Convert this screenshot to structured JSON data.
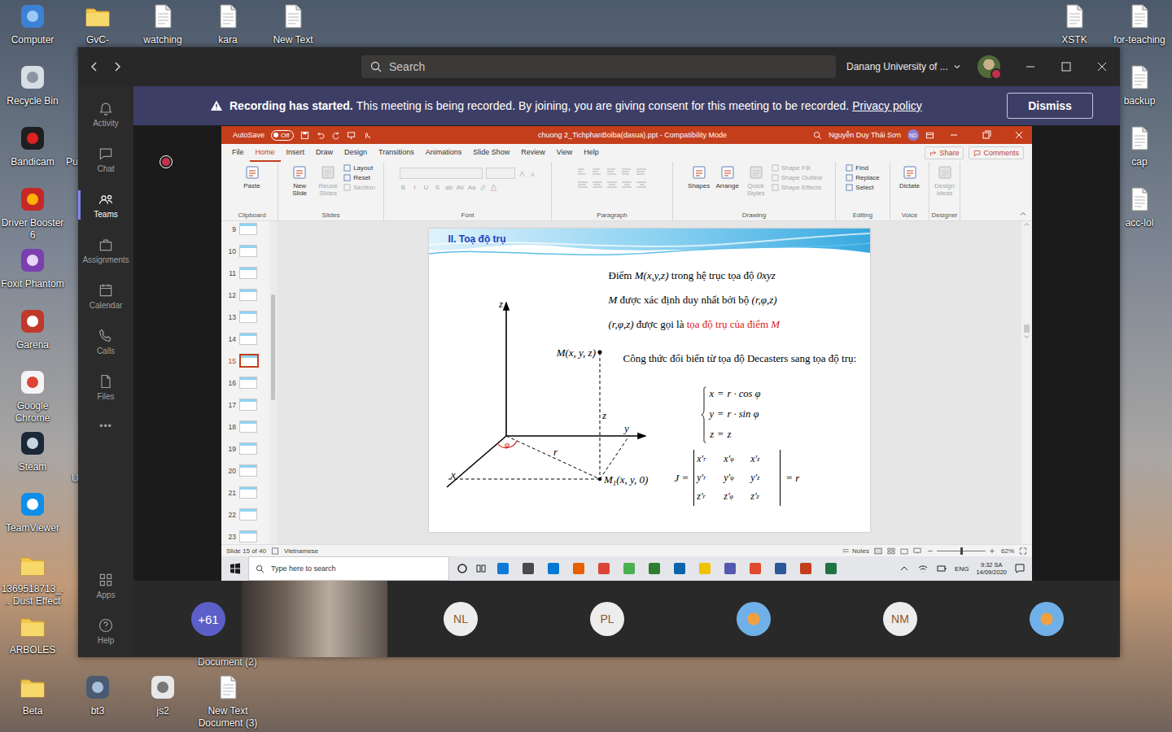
{
  "desktop": {
    "icons": [
      {
        "label": "Computer",
        "kind": "app"
      },
      {
        "label": "GvC-Launcher",
        "kind": "folder"
      },
      {
        "label": "watching",
        "kind": "file"
      },
      {
        "label": "kara",
        "kind": "file"
      },
      {
        "label": "New Text",
        "kind": "file"
      },
      {
        "label": "XSTK",
        "kind": "file"
      },
      {
        "label": "for-teaching",
        "kind": "file"
      },
      {
        "label": "Recycle Bin",
        "kind": "app"
      },
      {
        "label": "backup",
        "kind": "file"
      },
      {
        "label": "Bandicam",
        "kind": "app"
      },
      {
        "label": "cap",
        "kind": "file"
      },
      {
        "label": "Driver Booster 6",
        "kind": "app"
      },
      {
        "label": "acc-lol",
        "kind": "file"
      },
      {
        "label": "Foxit Phantom",
        "kind": "app"
      },
      {
        "label": "Garena",
        "kind": "app"
      },
      {
        "label": "Google Chrome",
        "kind": "app"
      },
      {
        "label": "Steam",
        "kind": "app"
      },
      {
        "label": "TeamViewer",
        "kind": "app"
      },
      {
        "label": "1369518713_... Dust Effect",
        "kind": "folder"
      },
      {
        "label": "ARBOLES",
        "kind": "folder"
      },
      {
        "label": "Beta",
        "kind": "folder"
      },
      {
        "label": "bt3",
        "kind": "app"
      },
      {
        "label": "js2",
        "kind": "app"
      },
      {
        "label": "New Text Document (3)",
        "kind": "file"
      }
    ],
    "partial_labels": [
      "Pu",
      "U",
      "Document (2)"
    ]
  },
  "teams": {
    "search_placeholder": "Search",
    "org": "Danang University of ...",
    "presence": "busy",
    "rail": [
      {
        "label": "Activity",
        "selected": false
      },
      {
        "label": "Chat",
        "selected": false
      },
      {
        "label": "Teams",
        "selected": true
      },
      {
        "label": "Assignments",
        "selected": false
      },
      {
        "label": "Calendar",
        "selected": false
      },
      {
        "label": "Calls",
        "selected": false
      },
      {
        "label": "Files",
        "selected": false
      }
    ],
    "rail_more": "•••",
    "rail_bottom": [
      {
        "label": "Apps"
      },
      {
        "label": "Help"
      }
    ],
    "banner": {
      "bold": "Recording has started.",
      "text": "This meeting is being recorded. By joining, you are giving consent for this meeting to be recorded.",
      "link": "Privacy policy",
      "button": "Dismiss"
    },
    "recording": true,
    "participants": [
      {
        "kind": "count",
        "label": "+61"
      },
      {
        "kind": "video",
        "label": ""
      },
      {
        "kind": "initials",
        "label": "NL"
      },
      {
        "kind": "initials",
        "label": "PL"
      },
      {
        "kind": "photo",
        "label": ""
      },
      {
        "kind": "initials",
        "label": "NM"
      },
      {
        "kind": "photo",
        "label": ""
      }
    ]
  },
  "presentation": {
    "autosave": {
      "label": "AutoSave",
      "state": "Off",
      "on": false
    },
    "title": "chuong 2_TichphanBoiba(dasua).ppt - Compatibility Mode",
    "user": "Nguyễn Duy Thái Sơn",
    "initials": "ND",
    "tabs": [
      {
        "label": "File",
        "selected": false
      },
      {
        "label": "Home",
        "selected": true
      },
      {
        "label": "Insert",
        "selected": false
      },
      {
        "label": "Draw",
        "selected": false
      },
      {
        "label": "Design",
        "selected": false
      },
      {
        "label": "Transitions",
        "selected": false
      },
      {
        "label": "Animations",
        "selected": false
      },
      {
        "label": "Slide Show",
        "selected": false
      },
      {
        "label": "Review",
        "selected": false
      },
      {
        "label": "View",
        "selected": false
      },
      {
        "label": "Help",
        "selected": false
      }
    ],
    "share": "Share",
    "comments": "Comments",
    "ribbon": [
      {
        "label": "Clipboard",
        "kind": "buttons",
        "items": [
          {
            "label": "Paste",
            "size": "large",
            "disabled": false
          }
        ]
      },
      {
        "label": "Slides",
        "kind": "buttons",
        "items": [
          {
            "label": "New Slide",
            "size": "large",
            "disabled": false
          },
          {
            "label": "Reuse Slides",
            "size": "large",
            "disabled": true
          },
          {
            "label": "Layout",
            "size": "small",
            "disabled": false
          },
          {
            "label": "Reset",
            "size": "small",
            "disabled": false
          },
          {
            "label": "Section",
            "size": "small",
            "disabled": true
          }
        ]
      },
      {
        "label": "Font",
        "kind": "font",
        "items": [],
        "glyphs": [
          "B",
          "I",
          "U",
          "S",
          "ab",
          "AV",
          "Aa"
        ]
      },
      {
        "label": "Paragraph",
        "kind": "paragraph",
        "items": []
      },
      {
        "label": "Drawing",
        "kind": "buttons",
        "items": [
          {
            "label": "Shapes",
            "size": "large",
            "disabled": false
          },
          {
            "label": "Arrange",
            "size": "large",
            "disabled": false
          },
          {
            "label": "Quick Styles",
            "size": "large",
            "disabled": true
          },
          {
            "label": "Shape Fill",
            "size": "small",
            "disabled": true
          },
          {
            "label": "Shape Outline",
            "size": "small",
            "disabled": true
          },
          {
            "label": "Shape Effects",
            "size": "small",
            "disabled": true
          }
        ]
      },
      {
        "label": "Editing",
        "kind": "buttons",
        "items": [
          {
            "label": "Find",
            "size": "small",
            "disabled": false
          },
          {
            "label": "Replace",
            "size": "small",
            "disabled": false
          },
          {
            "label": "Select",
            "size": "small",
            "disabled": false
          }
        ]
      },
      {
        "label": "Voice",
        "kind": "buttons",
        "items": [
          {
            "label": "Dictate",
            "size": "large",
            "disabled": false
          }
        ]
      },
      {
        "label": "Designer",
        "kind": "buttons",
        "items": [
          {
            "label": "Design Ideas",
            "size": "large",
            "disabled": true
          }
        ]
      }
    ],
    "slides": [
      {
        "number": "9",
        "selected": false
      },
      {
        "number": "10",
        "selected": false
      },
      {
        "number": "11",
        "selected": false
      },
      {
        "number": "12",
        "selected": false
      },
      {
        "number": "13",
        "selected": false
      },
      {
        "number": "14",
        "selected": false
      },
      {
        "number": "15",
        "selected": true
      },
      {
        "number": "16",
        "selected": false
      },
      {
        "number": "17",
        "selected": false
      },
      {
        "number": "18",
        "selected": false
      },
      {
        "number": "19",
        "selected": false
      },
      {
        "number": "20",
        "selected": false
      },
      {
        "number": "21",
        "selected": false
      },
      {
        "number": "22",
        "selected": false
      },
      {
        "number": "23",
        "selected": false
      }
    ],
    "slide": {
      "title": "II. Toạ độ trụ",
      "lines": [
        [
          {
            "text": "Điểm ",
            "italic": false,
            "highlight": false
          },
          {
            "text": "M(x,y,z)",
            "italic": true,
            "highlight": false
          },
          {
            "text": " trong hệ trục tọa độ ",
            "italic": false,
            "highlight": false
          },
          {
            "text": "0xyz",
            "italic": true,
            "highlight": false
          }
        ],
        [
          {
            "text": "M",
            "italic": true,
            "highlight": false
          },
          {
            "text": " được xác định duy nhất bởi bộ ",
            "italic": false,
            "highlight": false
          },
          {
            "text": "(r,φ,z)",
            "italic": true,
            "highlight": false
          }
        ],
        [
          {
            "text": "(r,φ,z)",
            "italic": true,
            "highlight": false
          },
          {
            "text": " được gọi là ",
            "italic": false,
            "highlight": false
          },
          {
            "text": "tọa độ trụ của điểm ",
            "italic": false,
            "highlight": true
          },
          {
            "text": "M",
            "italic": true,
            "highlight": true
          }
        ]
      ],
      "description": "Công thức đổi biến từ tọa độ Decasters sang tọa độ trụ:",
      "system": [
        {
          "lhs": "x",
          "op": "=",
          "rhs": "r · cos φ"
        },
        {
          "lhs": "y",
          "op": "=",
          "rhs": "r · sin φ"
        },
        {
          "lhs": "z",
          "op": "=",
          "rhs": "z"
        }
      ],
      "jacobian": {
        "symbol": "J =",
        "entries": [
          [
            {
              "base": "x'",
              "sub": "r"
            },
            {
              "base": "x'",
              "sub": "φ"
            },
            {
              "base": "x'",
              "sub": "z"
            }
          ],
          [
            {
              "base": "y'",
              "sub": "r"
            },
            {
              "base": "y'",
              "sub": "φ"
            },
            {
              "base": "y'",
              "sub": "z"
            }
          ],
          [
            {
              "base": "z'",
              "sub": "r"
            },
            {
              "base": "z'",
              "sub": "φ"
            },
            {
              "base": "z'",
              "sub": "z"
            }
          ]
        ],
        "result": "= r"
      },
      "diagram": {
        "axes": {
          "z": "z",
          "y": "y",
          "x": "x"
        },
        "radius_label": "r",
        "height_label": "z",
        "angle_label": "φ",
        "point": "M(x, y, z)",
        "projection": {
          "base": "M",
          "sub": "1",
          "rest": "(x, y, 0)"
        }
      }
    },
    "status": {
      "slide": "Slide 15 of 40",
      "language": "Vietnamese",
      "notes": "Notes",
      "zoom": "62%",
      "zoom_level": 0.5
    },
    "taskbar": {
      "search": "Type here to search",
      "language": "ENG",
      "time": "9:32 SA",
      "date": "14/09/2020"
    }
  }
}
